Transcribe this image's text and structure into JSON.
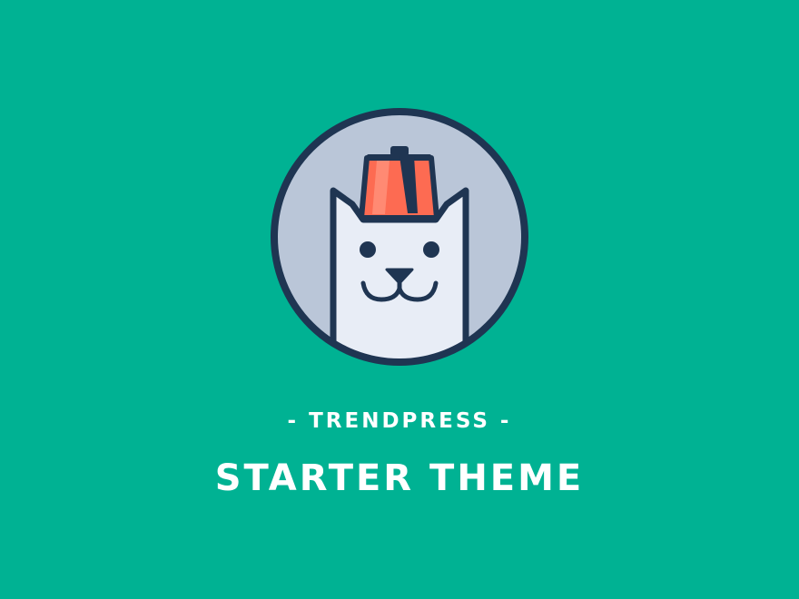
{
  "brand": {
    "subtitle": "- TRENDPRESS -",
    "title": "STARTER THEME"
  },
  "logo": {
    "icon": "cat-with-fez-icon"
  },
  "colors": {
    "background": "#00b293",
    "text": "#ffffff",
    "outline": "#1f3552",
    "circle_fill": "#bac6d8",
    "cat_fill": "#e8edf6",
    "fez": "#fd6b52",
    "fez_highlight": "#ff8a73"
  }
}
